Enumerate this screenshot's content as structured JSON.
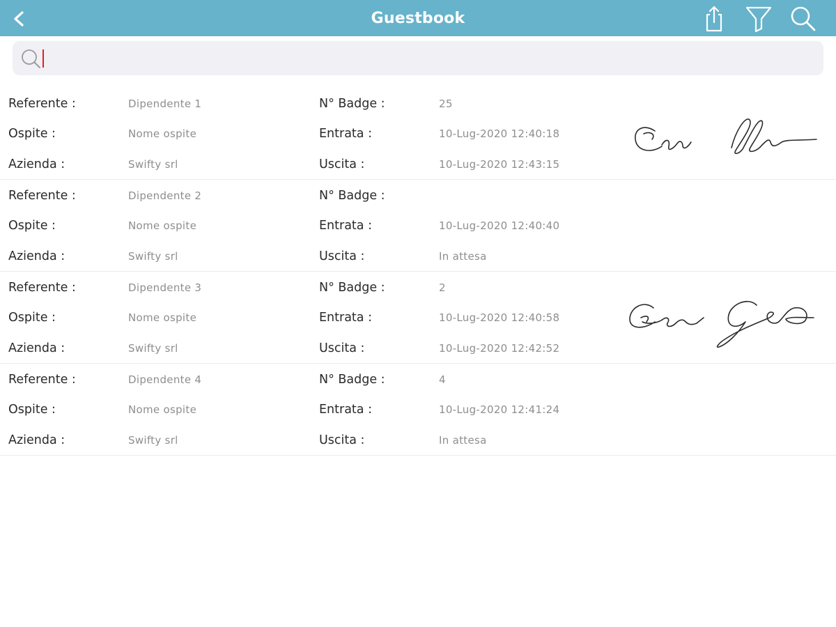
{
  "header": {
    "title": "Guestbook",
    "back_icon": "chevron-left-icon",
    "actions": [
      {
        "name": "share",
        "icon": "share-icon"
      },
      {
        "name": "filter",
        "icon": "filter-icon"
      },
      {
        "name": "search",
        "icon": "search-icon"
      }
    ],
    "background_color": "#66b3cb"
  },
  "search": {
    "placeholder": "",
    "value": ""
  },
  "labels": {
    "referente": "Referente :",
    "ospite": "Ospite :",
    "azienda": "Azienda :",
    "badge": "N° Badge :",
    "entrata": "Entrata :",
    "uscita": "Uscita :"
  },
  "entries": [
    {
      "referente": "Dipendente  1",
      "ospite": "Nome ospite",
      "azienda": "Swifty srl",
      "badge": "25",
      "entrata": "10-Lug-2020 12:40:18",
      "uscita": "10-Lug-2020 12:43:15",
      "has_signature": true
    },
    {
      "referente": "Dipendente 2",
      "ospite": "Nome ospite",
      "azienda": "Swifty srl",
      "badge": "",
      "entrata": "10-Lug-2020 12:40:40",
      "uscita": "In attesa",
      "has_signature": false
    },
    {
      "referente": "Dipendente 3",
      "ospite": "Nome ospite",
      "azienda": "Swifty srl",
      "badge": "2",
      "entrata": "10-Lug-2020 12:40:58",
      "uscita": "10-Lug-2020 12:42:52",
      "has_signature": true
    },
    {
      "referente": "Dipendente 4",
      "ospite": "Nome ospite",
      "azienda": "Swifty srl",
      "badge": "4",
      "entrata": "10-Lug-2020 12:41:24",
      "uscita": "In attesa",
      "has_signature": false
    }
  ]
}
